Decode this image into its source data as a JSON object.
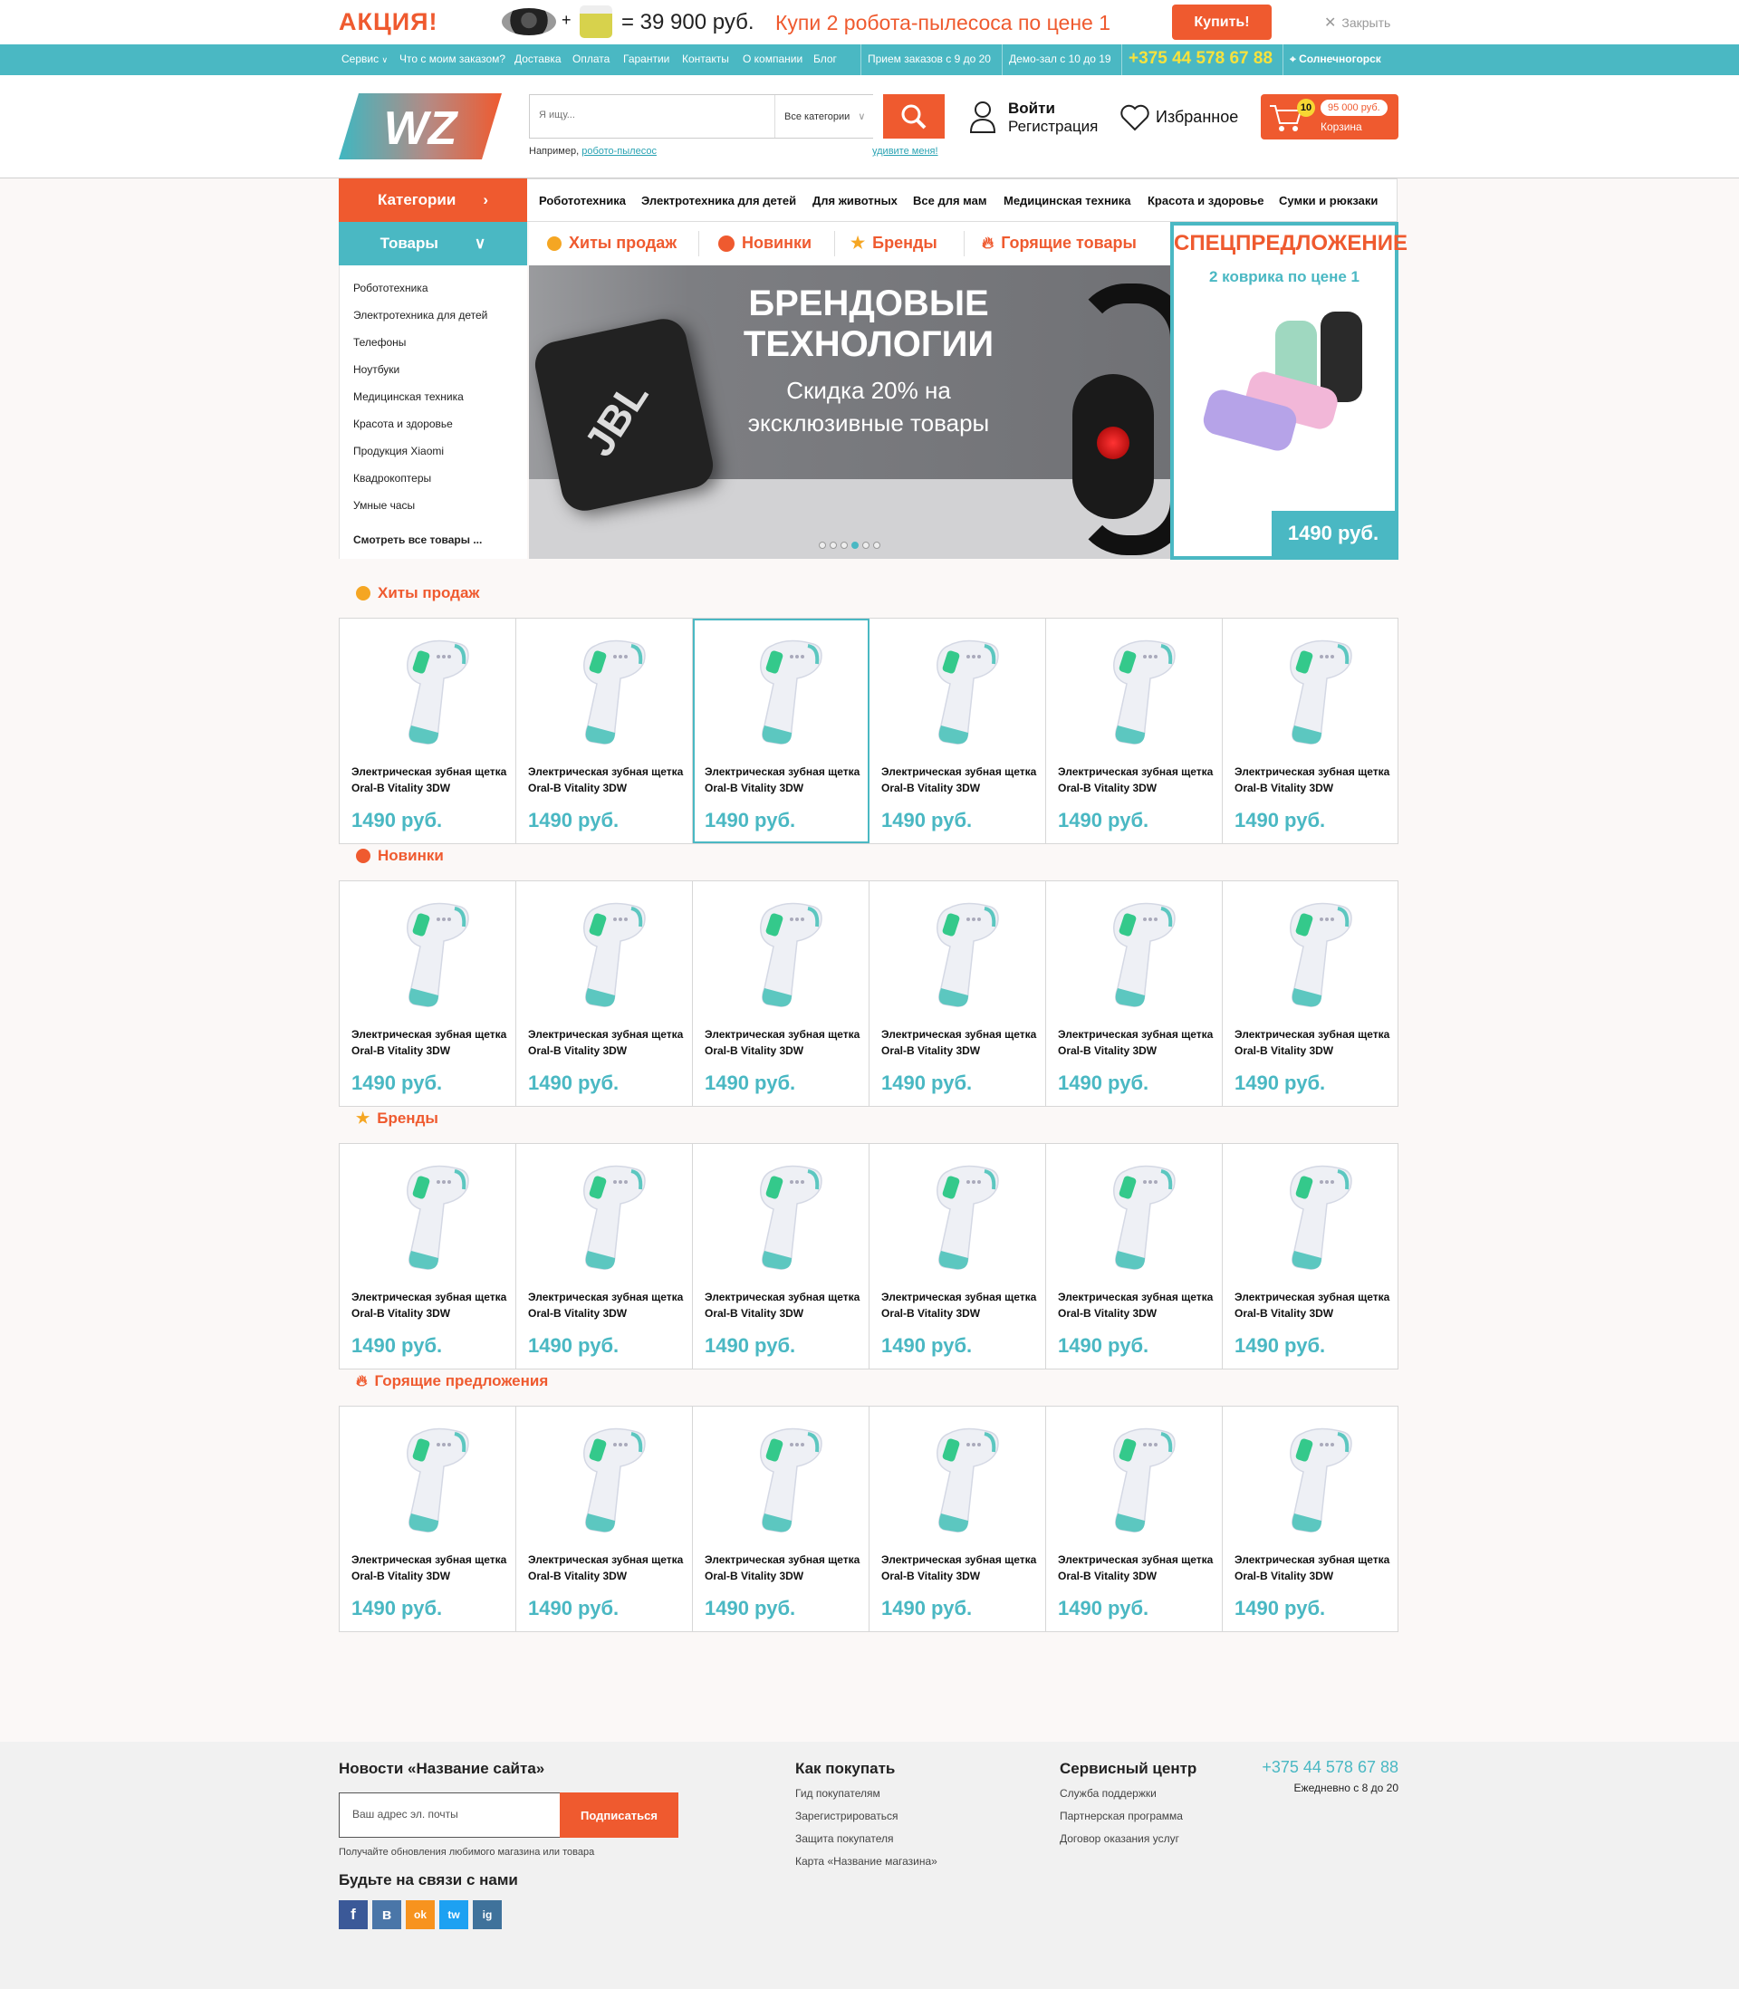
{
  "promo": {
    "title": "АКЦИЯ!",
    "plus": "+",
    "price": "= 39 900 руб.",
    "offer": "Купи 2 робота-пылесоса по цене 1",
    "buy": "Купить!",
    "close": "Закрыть"
  },
  "topnav": {
    "items": [
      "Сервис",
      "Что с моим заказом?",
      "Доставка",
      "Оплата",
      "Гарантии",
      "Контакты",
      "О компании",
      "Блог"
    ],
    "hours_orders": "Прием заказов с 9 до 20",
    "hours_demo": "Демо-зал с 10 до 19",
    "phone": "+375 44 578 67 88",
    "city": "Солнечногорск"
  },
  "header": {
    "logo": "WZ",
    "search_placeholder": "Я ищу...",
    "search_category": "Все категории",
    "hint_prefix": "Например,",
    "hint_link": "робото-пылесос",
    "surprise": "удивите меня!",
    "login": "Войти",
    "register": "Регистрация",
    "favorites": "Избранное",
    "cart_count": "10",
    "cart_sum": "95 000 руб.",
    "cart_label": "Корзина"
  },
  "catbar": {
    "categories_btn": "Категории",
    "goods_btn": "Товары",
    "items": [
      "Робототехника",
      "Электротехника для детей",
      "Для животных",
      "Все для мам",
      "Медицинская техника",
      "Красота и здоровье",
      "Сумки и рюкзаки"
    ]
  },
  "tabs": [
    "Хиты продаж",
    "Новинки",
    "Бренды",
    "Горящие товары"
  ],
  "sidebar": {
    "items": [
      "Робототехника",
      "Электротехника для детей",
      "Телефоны",
      "Ноутбуки",
      "Медицинская техника",
      "Красота и здоровье",
      "Продукция Xiaomi",
      "Квадрокоптеры",
      "Умные часы"
    ],
    "all": "Смотреть все товары ..."
  },
  "banner": {
    "line1": "БРЕНДОВЫЕ",
    "line2": "ТЕХНОЛОГИИ",
    "line3": "Скидка 20% на",
    "line4": "эксклюзивные товары",
    "speaker_brand": "JBL",
    "dots_total": 6,
    "dot_active": 4
  },
  "special": {
    "title": "СПЕЦПРЕДЛОЖЕНИЕ",
    "subtitle": "2 коврика по цене 1",
    "price": "1490 руб."
  },
  "product": {
    "name_line1": "Электрическая зубная щетка",
    "name_line2": "Oral-B Vitality 3DW",
    "price": "1490 руб."
  },
  "sections": [
    {
      "title": "Хиты продаж",
      "icon": "hits-icon",
      "highlighted_card": 3
    },
    {
      "title": "Новинки",
      "icon": "new-icon",
      "highlighted_card": 0
    },
    {
      "title": "Бренды",
      "icon": "star-icon",
      "highlighted_card": 0
    },
    {
      "title": "Горящие предложения",
      "icon": "fire-icon",
      "highlighted_card": 0
    }
  ],
  "footer": {
    "news_title": "Новости «Название сайта»",
    "email_placeholder": "Ваш адрес эл. почты",
    "subscribe": "Подписаться",
    "subscribe_note": "Получайте обновления любимого магазина или товара",
    "social_title": "Будьте на связи с нами",
    "social": [
      "f",
      "в",
      "ok",
      "tw",
      "ig"
    ],
    "how_title": "Как покупать",
    "how_links": [
      "Гид покупателям",
      "Зарегистрироваться",
      "Защита покупателя",
      "Карта «Название магазина»"
    ],
    "service_title": "Сервисный центр",
    "service_links": [
      "Служба поддержки",
      "Партнерская программа",
      "Договор оказания услуг"
    ],
    "phone": "+375 44 578 67 88",
    "hours": "Ежедневно с 8 до 20"
  },
  "colors": {
    "accent": "#ef5a2f",
    "teal": "#4ab8c3",
    "yellow": "#f7e23d"
  }
}
